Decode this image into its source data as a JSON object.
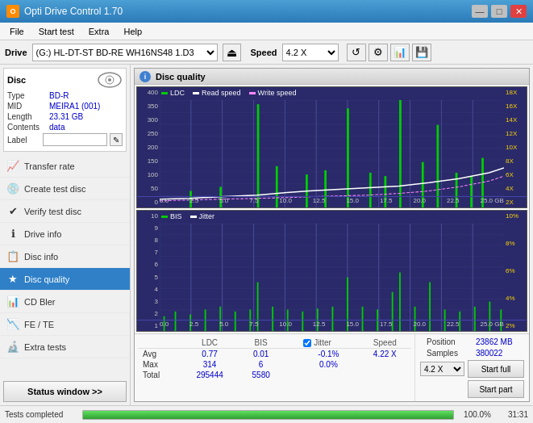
{
  "titleBar": {
    "icon": "O",
    "title": "Opti Drive Control 1.70",
    "minBtn": "—",
    "maxBtn": "□",
    "closeBtn": "✕"
  },
  "menuBar": {
    "items": [
      "File",
      "Start test",
      "Extra",
      "Help"
    ]
  },
  "driveToolbar": {
    "driveLabel": "Drive",
    "driveValue": "(G:)  HL-DT-ST BD-RE  WH16NS48 1.D3",
    "speedLabel": "Speed",
    "speedValue": "4.2 X",
    "ejectIcon": "⏏"
  },
  "discPanel": {
    "title": "Disc",
    "fields": {
      "type": {
        "label": "Type",
        "value": "BD-R"
      },
      "mid": {
        "label": "MID",
        "value": "MEIRA1 (001)"
      },
      "length": {
        "label": "Length",
        "value": "23.31 GB"
      },
      "contents": {
        "label": "Contents",
        "value": "data"
      },
      "label": {
        "label": "Label",
        "placeholder": ""
      }
    }
  },
  "navItems": [
    {
      "id": "transfer-rate",
      "label": "Transfer rate",
      "icon": "📈"
    },
    {
      "id": "create-test-disc",
      "label": "Create test disc",
      "icon": "💿"
    },
    {
      "id": "verify-test-disc",
      "label": "Verify test disc",
      "icon": "✔"
    },
    {
      "id": "drive-info",
      "label": "Drive info",
      "icon": "ℹ"
    },
    {
      "id": "disc-info",
      "label": "Disc info",
      "icon": "📋"
    },
    {
      "id": "disc-quality",
      "label": "Disc quality",
      "icon": "★",
      "active": true
    },
    {
      "id": "cd-bler",
      "label": "CD Bler",
      "icon": "📊"
    },
    {
      "id": "fe-te",
      "label": "FE / TE",
      "icon": "📉"
    },
    {
      "id": "extra-tests",
      "label": "Extra tests",
      "icon": "🔬"
    }
  ],
  "statusBtn": "Status window >>",
  "progressBar": {
    "label": "Tests completed",
    "percent": 100,
    "percentText": "100.0%",
    "time": "31:31"
  },
  "discQuality": {
    "title": "Disc quality",
    "icon": "i",
    "chart1": {
      "legend": [
        {
          "label": "LDC",
          "color": "#00aa00"
        },
        {
          "label": "Read speed",
          "color": "white"
        },
        {
          "label": "Write speed",
          "color": "#ff88ff"
        }
      ],
      "yLabels": [
        "400",
        "350",
        "300",
        "250",
        "200",
        "150",
        "100",
        "50",
        "0"
      ],
      "yLabelsRight": [
        "18X",
        "16X",
        "14X",
        "12X",
        "10X",
        "8X",
        "6X",
        "4X",
        "2X"
      ],
      "xLabels": [
        "0.0",
        "2.5",
        "5.0",
        "7.5",
        "10.0",
        "12.5",
        "15.0",
        "17.5",
        "20.0",
        "22.5",
        "25.0 GB"
      ]
    },
    "chart2": {
      "legend": [
        {
          "label": "BIS",
          "color": "#00aa00"
        },
        {
          "label": "Jitter",
          "color": "white"
        }
      ],
      "yLabels": [
        "10",
        "9",
        "8",
        "7",
        "6",
        "5",
        "4",
        "3",
        "2",
        "1"
      ],
      "yLabelsRight": [
        "10%",
        "8%",
        "6%",
        "4%",
        "2%"
      ],
      "xLabels": [
        "0.0",
        "2.5",
        "5.0",
        "7.5",
        "10.0",
        "12.5",
        "15.0",
        "17.5",
        "20.0",
        "22.5",
        "25.0 GB"
      ]
    },
    "statsTable": {
      "headers": [
        "",
        "LDC",
        "BIS",
        "",
        "Jitter",
        "Speed"
      ],
      "rows": [
        {
          "label": "Avg",
          "ldc": "0.77",
          "bis": "0.01",
          "jitter": "-0.1%",
          "speed": "4.22 X"
        },
        {
          "label": "Max",
          "ldc": "314",
          "bis": "6",
          "jitter": "0.0%",
          "speed": ""
        },
        {
          "label": "Total",
          "ldc": "295444",
          "bis": "5580",
          "jitter": "",
          "speed": ""
        }
      ],
      "jitterChecked": true,
      "jitterLabel": "Jitter",
      "position": {
        "label": "Position",
        "value": "23862 MB"
      },
      "samples": {
        "label": "Samples",
        "value": "380022"
      },
      "speedDropdown": "4.2 X",
      "startFullBtn": "Start full",
      "startPartBtn": "Start part"
    }
  }
}
